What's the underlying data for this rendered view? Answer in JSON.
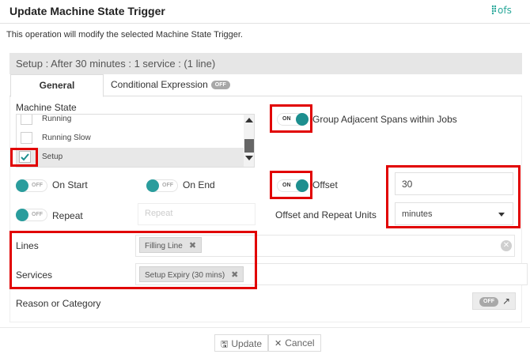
{
  "dialog": {
    "title": "Update Machine State Trigger",
    "description": "This operation will modify the selected Machine State Trigger.",
    "logo_text": "ofs"
  },
  "setup_bar": "Setup : After 30 minutes : 1 service : (1 line)",
  "tabs": {
    "general": "General",
    "conditional": "Conditional Expression",
    "conditional_toggle": "OFF"
  },
  "machine_state": {
    "label": "Machine State",
    "items": [
      {
        "label": "Running",
        "selected": false
      },
      {
        "label": "Running Slow",
        "selected": false
      },
      {
        "label": "Setup",
        "selected": true
      }
    ]
  },
  "group_adjacent": {
    "state": "ON",
    "label": "Group Adjacent Spans within Jobs"
  },
  "on_start": {
    "state": "OFF",
    "label": "On Start"
  },
  "on_end": {
    "state": "OFF",
    "label": "On End"
  },
  "offset": {
    "state": "ON",
    "label": "Offset",
    "value": "30"
  },
  "repeat": {
    "state": "OFF",
    "label": "Repeat",
    "placeholder": "Repeat"
  },
  "units": {
    "label": "Offset and Repeat Units",
    "value": "minutes"
  },
  "lines": {
    "label": "Lines",
    "tags": [
      "Filling Line"
    ]
  },
  "services": {
    "label": "Services",
    "tags": [
      "Setup Expiry (30 mins)"
    ]
  },
  "reason": {
    "label": "Reason or Category",
    "toggle": "OFF"
  },
  "footer": {
    "update": "Update",
    "cancel": "Cancel"
  },
  "colors": {
    "accent": "#1d8f8f",
    "highlight": "#e10000"
  }
}
